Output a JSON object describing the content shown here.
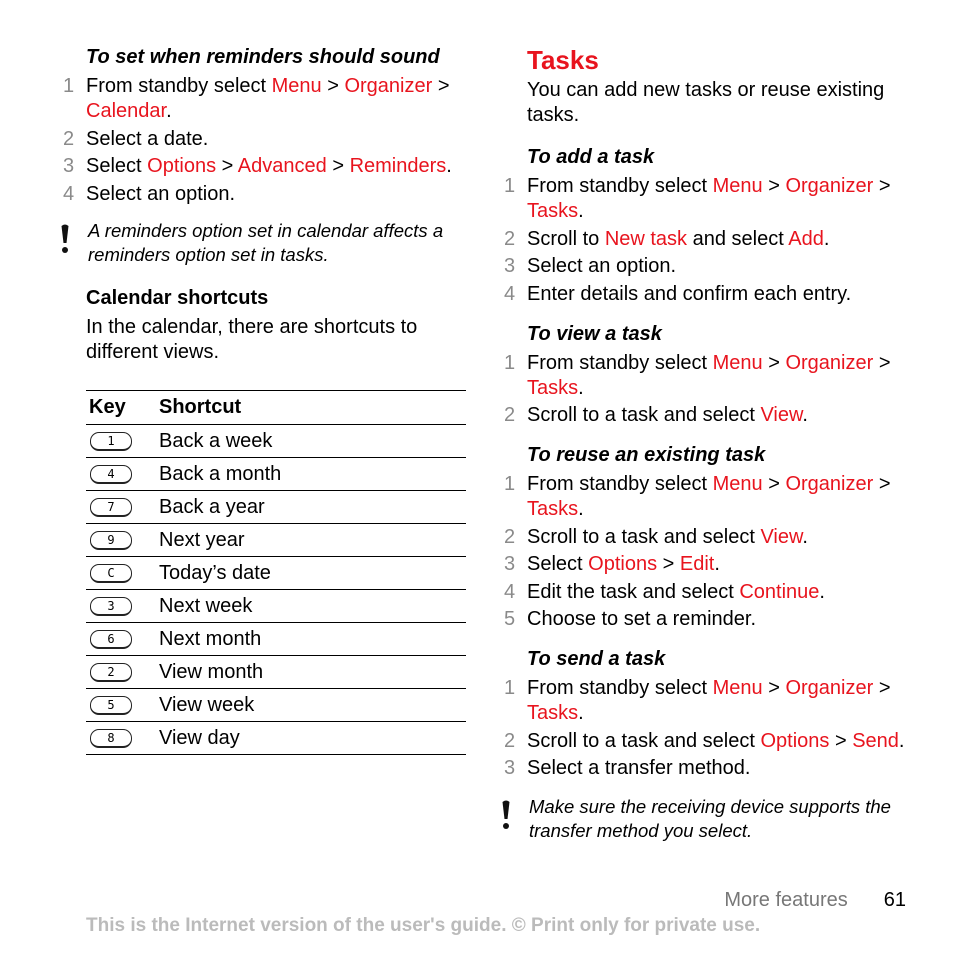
{
  "left": {
    "reminder_proc": {
      "title": "To set when reminders should sound",
      "steps": [
        {
          "num": "1",
          "parts": [
            {
              "t": "From standby select "
            },
            {
              "t": "Menu",
              "r": true
            },
            {
              "t": " > "
            },
            {
              "t": "Organizer",
              "r": true
            },
            {
              "t": " > "
            },
            {
              "t": "Calendar",
              "r": true
            },
            {
              "t": "."
            }
          ]
        },
        {
          "num": "2",
          "parts": [
            {
              "t": "Select a date."
            }
          ]
        },
        {
          "num": "3",
          "parts": [
            {
              "t": "Select "
            },
            {
              "t": "Options",
              "r": true
            },
            {
              "t": " > "
            },
            {
              "t": "Advanced",
              "r": true
            },
            {
              "t": " > "
            },
            {
              "t": "Reminders",
              "r": true
            },
            {
              "t": "."
            }
          ]
        },
        {
          "num": "4",
          "parts": [
            {
              "t": "Select an option."
            }
          ]
        }
      ]
    },
    "note": "A reminders option set in calendar affects a reminders option set in tasks.",
    "shortcuts_heading": "Calendar shortcuts",
    "shortcuts_intro": "In the calendar, there are shortcuts to different views.",
    "table": {
      "headers": [
        "Key",
        "Shortcut"
      ],
      "rows": [
        {
          "key": "1",
          "shortcut": "Back a week"
        },
        {
          "key": "4",
          "shortcut": "Back a month"
        },
        {
          "key": "7",
          "shortcut": "Back a year"
        },
        {
          "key": "9",
          "shortcut": "Next year"
        },
        {
          "key": "C",
          "shortcut": "Today’s date"
        },
        {
          "key": "3",
          "shortcut": "Next week"
        },
        {
          "key": "6",
          "shortcut": "Next month"
        },
        {
          "key": "2",
          "shortcut": "View month"
        },
        {
          "key": "5",
          "shortcut": "View week"
        },
        {
          "key": "8",
          "shortcut": "View day"
        }
      ]
    }
  },
  "right": {
    "title": "Tasks",
    "intro": "You can add new tasks or reuse existing tasks.",
    "procedures": [
      {
        "title": "To add a task",
        "steps": [
          {
            "num": "1",
            "parts": [
              {
                "t": "From standby select "
              },
              {
                "t": "Menu",
                "r": true
              },
              {
                "t": " > "
              },
              {
                "t": "Organizer",
                "r": true
              },
              {
                "t": " > "
              },
              {
                "t": "Tasks",
                "r": true
              },
              {
                "t": "."
              }
            ]
          },
          {
            "num": "2",
            "parts": [
              {
                "t": "Scroll to "
              },
              {
                "t": "New task",
                "r": true
              },
              {
                "t": " and select "
              },
              {
                "t": "Add",
                "r": true
              },
              {
                "t": "."
              }
            ]
          },
          {
            "num": "3",
            "parts": [
              {
                "t": "Select an option."
              }
            ]
          },
          {
            "num": "4",
            "parts": [
              {
                "t": "Enter details and confirm each entry."
              }
            ]
          }
        ]
      },
      {
        "title": "To view a task",
        "steps": [
          {
            "num": "1",
            "parts": [
              {
                "t": "From standby select "
              },
              {
                "t": "Menu",
                "r": true
              },
              {
                "t": " > "
              },
              {
                "t": "Organizer",
                "r": true
              },
              {
                "t": " > "
              },
              {
                "t": "Tasks",
                "r": true
              },
              {
                "t": "."
              }
            ]
          },
          {
            "num": "2",
            "parts": [
              {
                "t": "Scroll to a task and select "
              },
              {
                "t": "View",
                "r": true
              },
              {
                "t": "."
              }
            ]
          }
        ]
      },
      {
        "title": "To reuse an existing task",
        "steps": [
          {
            "num": "1",
            "parts": [
              {
                "t": "From standby select "
              },
              {
                "t": "Menu",
                "r": true
              },
              {
                "t": " > "
              },
              {
                "t": "Organizer",
                "r": true
              },
              {
                "t": " > "
              },
              {
                "t": "Tasks",
                "r": true
              },
              {
                "t": "."
              }
            ]
          },
          {
            "num": "2",
            "parts": [
              {
                "t": "Scroll to a task and select "
              },
              {
                "t": "View",
                "r": true
              },
              {
                "t": "."
              }
            ]
          },
          {
            "num": "3",
            "parts": [
              {
                "t": "Select "
              },
              {
                "t": "Options",
                "r": true
              },
              {
                "t": " > "
              },
              {
                "t": "Edit",
                "r": true
              },
              {
                "t": "."
              }
            ]
          },
          {
            "num": "4",
            "parts": [
              {
                "t": "Edit the task and select "
              },
              {
                "t": "Continue",
                "r": true
              },
              {
                "t": "."
              }
            ]
          },
          {
            "num": "5",
            "parts": [
              {
                "t": "Choose to set a reminder."
              }
            ]
          }
        ]
      },
      {
        "title": "To send a task",
        "steps": [
          {
            "num": "1",
            "parts": [
              {
                "t": "From standby select "
              },
              {
                "t": "Menu",
                "r": true
              },
              {
                "t": " > "
              },
              {
                "t": "Organizer",
                "r": true
              },
              {
                "t": " > "
              },
              {
                "t": "Tasks",
                "r": true
              },
              {
                "t": "."
              }
            ]
          },
          {
            "num": "2",
            "parts": [
              {
                "t": "Scroll to a task and select "
              },
              {
                "t": "Options",
                "r": true
              },
              {
                "t": " > "
              },
              {
                "t": "Send",
                "r": true
              },
              {
                "t": "."
              }
            ]
          },
          {
            "num": "3",
            "parts": [
              {
                "t": "Select a transfer method."
              }
            ]
          }
        ]
      }
    ],
    "note": "Make sure the receiving device supports the transfer method you select."
  },
  "footer": {
    "section": "More features",
    "page_number": "61",
    "notice": "This is the Internet version of the user's guide. © Print only for private use."
  },
  "colors": {
    "accent_red": "#e8141e",
    "step_number_gray": "#8a8a8a",
    "footer_gray": "#bbbbbb"
  }
}
